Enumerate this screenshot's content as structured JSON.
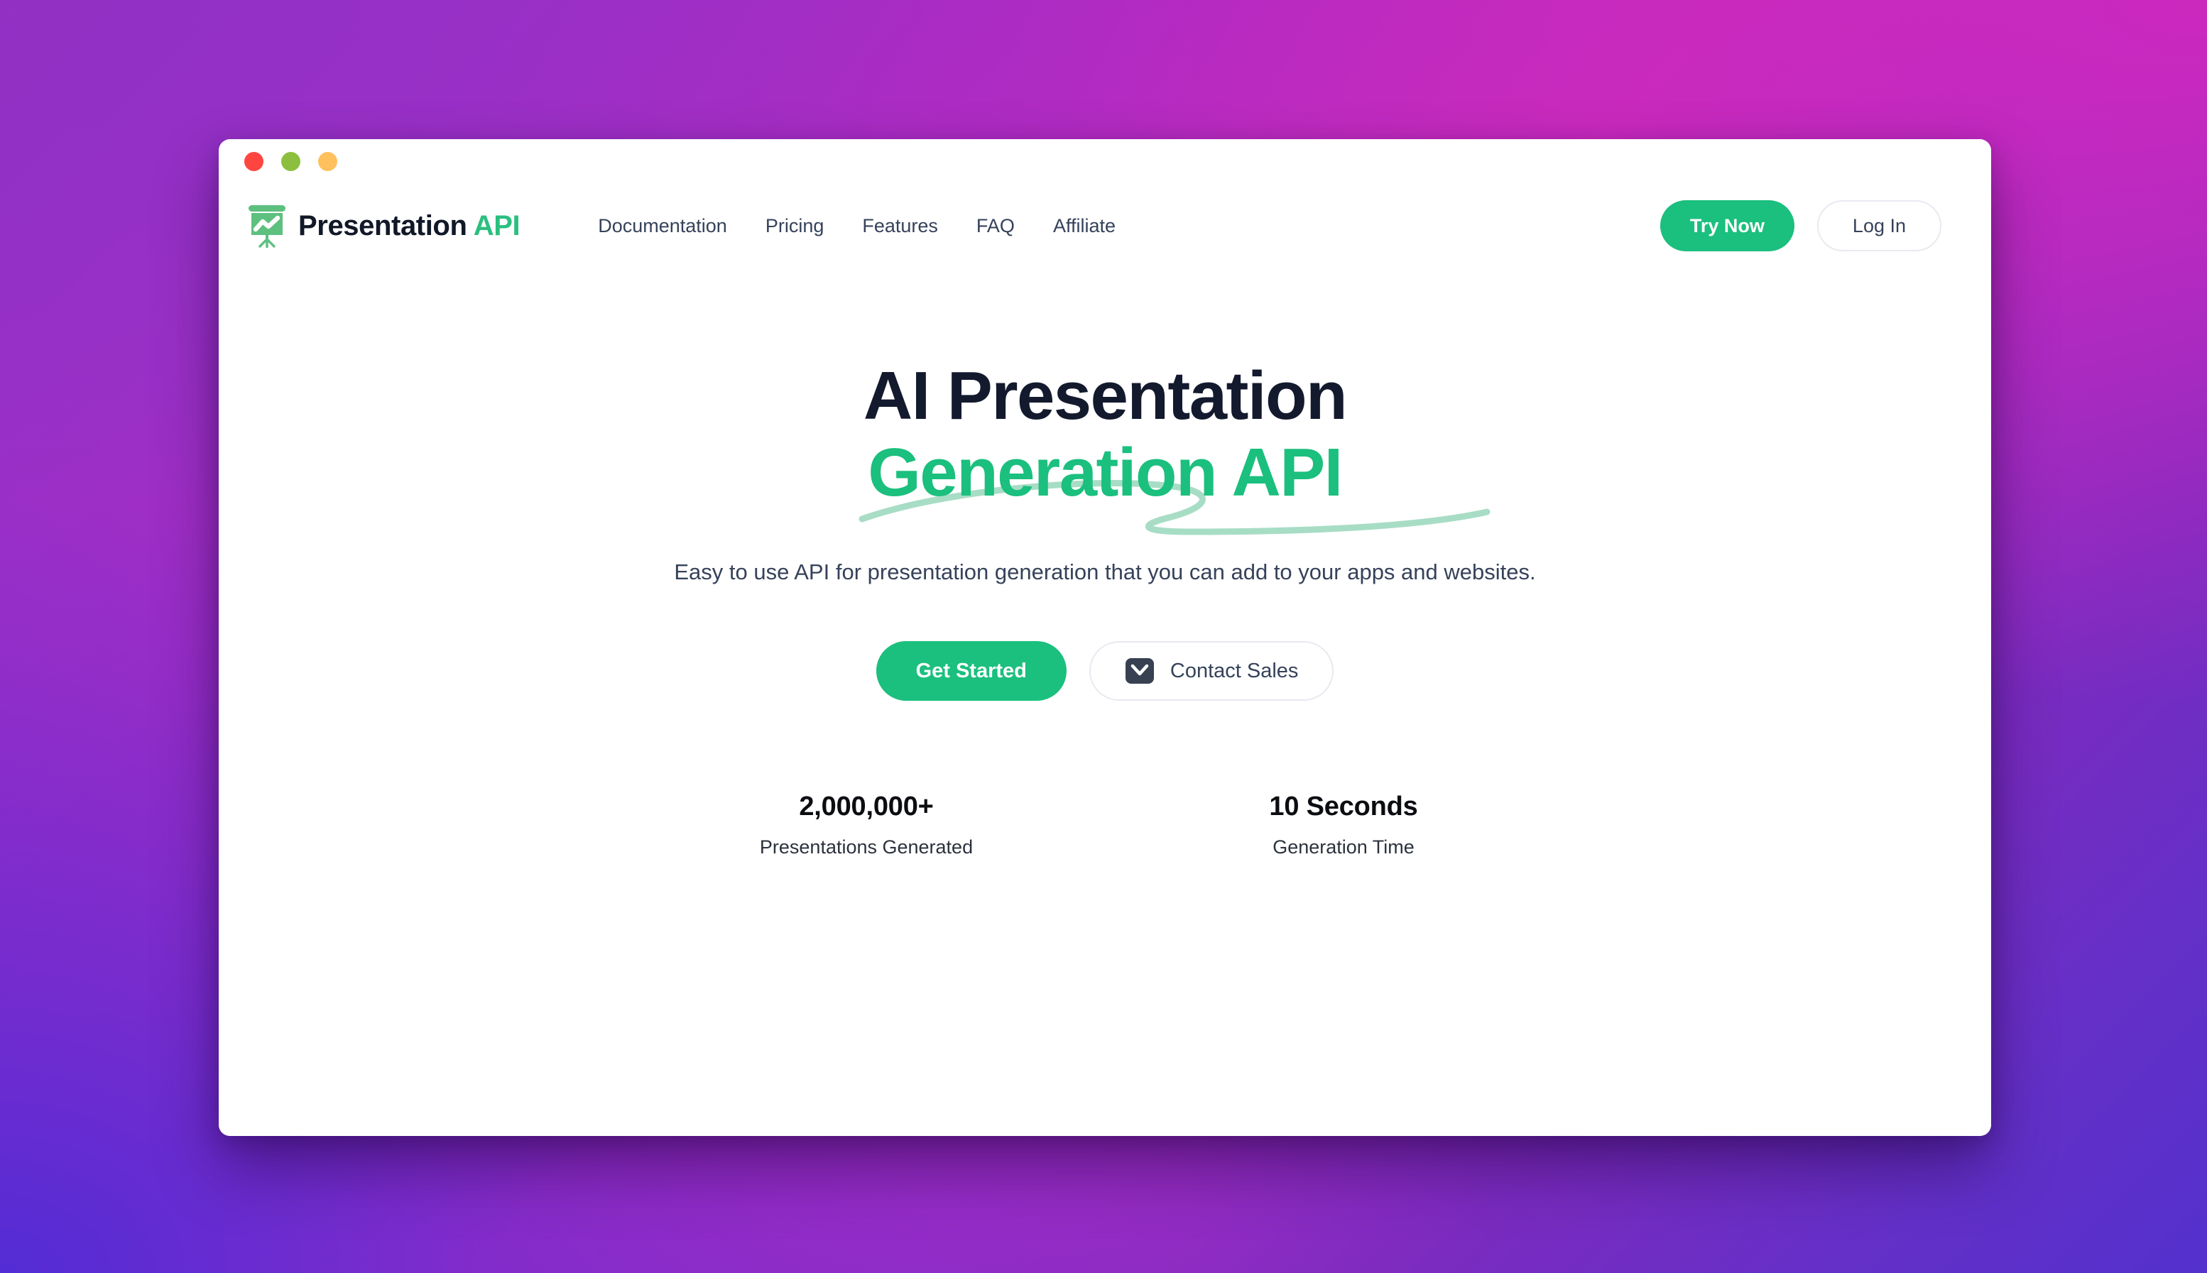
{
  "window": {
    "traffic_lights": [
      {
        "name": "close",
        "color": "#FF4540"
      },
      {
        "name": "minimize",
        "color": "#8CBF3F"
      },
      {
        "name": "maximize",
        "color": "#FFC15E"
      }
    ]
  },
  "brand": {
    "name_main": "Presentation",
    "name_accent": "API",
    "icon": "presentation-chart-icon"
  },
  "nav": {
    "items": [
      {
        "label": "Documentation"
      },
      {
        "label": "Pricing"
      },
      {
        "label": "Features"
      },
      {
        "label": "FAQ"
      },
      {
        "label": "Affiliate"
      }
    ]
  },
  "header_actions": {
    "try_now_label": "Try Now",
    "log_in_label": "Log In"
  },
  "hero": {
    "headline_line1": "AI Presentation",
    "headline_line2": "Generation API",
    "subhead": "Easy to use API for presentation generation that you can add to your apps and websites.",
    "cta_primary_label": "Get Started",
    "cta_secondary_label": "Contact Sales",
    "cta_secondary_icon": "envelope-icon"
  },
  "stats": [
    {
      "value": "2,000,000+",
      "label": "Presentations Generated"
    },
    {
      "value": "10 Seconds",
      "label": "Generation Time"
    }
  ],
  "colors": {
    "accent_green": "#1BBF7E",
    "accent_green_soft": "#A8DDC5",
    "headline_dark": "#131A2E",
    "body_text": "#36425A",
    "background_purple": "#9231C4",
    "background_magenta": "#C52BBC",
    "background_violet": "#5430CC"
  }
}
